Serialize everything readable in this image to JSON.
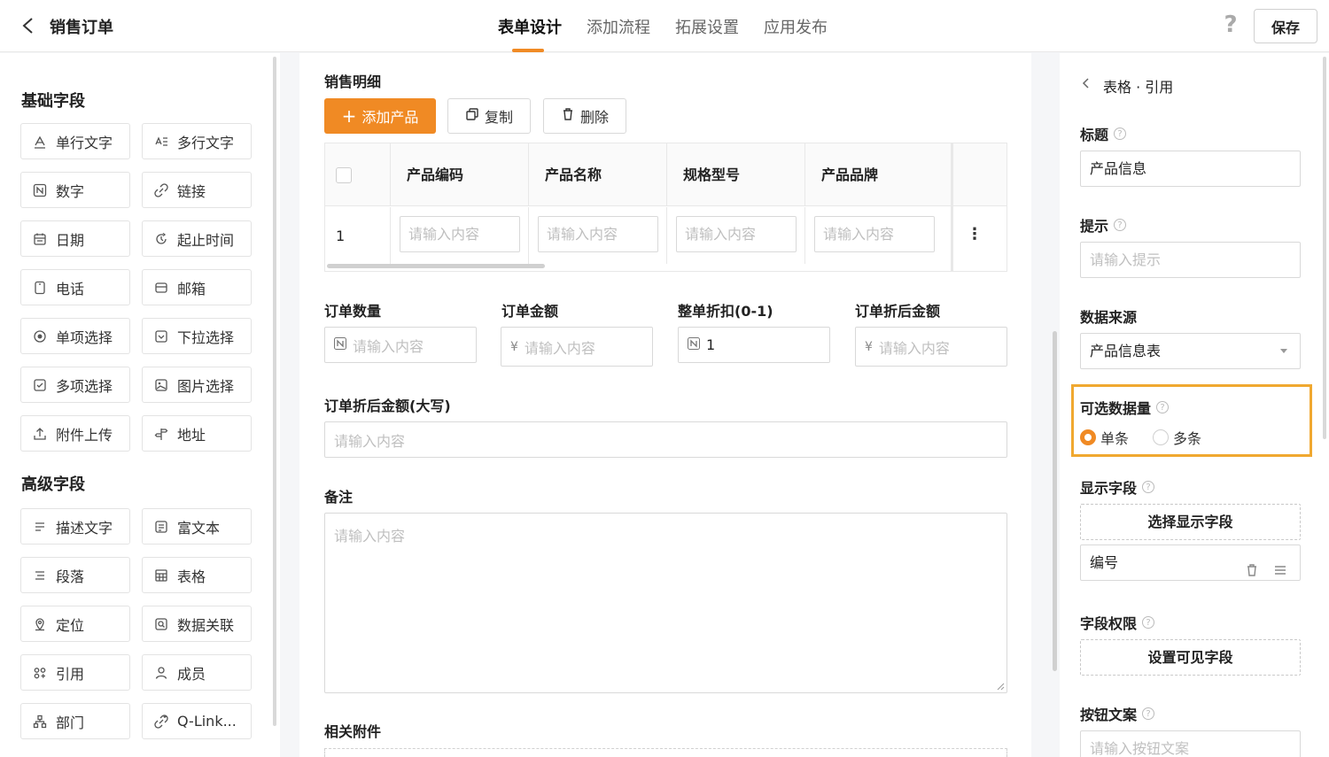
{
  "header": {
    "title": "销售订单",
    "tabs": [
      {
        "label": "表单设计",
        "active": true
      },
      {
        "label": "添加流程",
        "active": false
      },
      {
        "label": "拓展设置",
        "active": false
      },
      {
        "label": "应用发布",
        "active": false
      }
    ],
    "help_label": "?",
    "save_label": "保存",
    "accent_color": "#f08a24"
  },
  "left": {
    "basic_title": "基础字段",
    "basic_fields": [
      {
        "label": "单行文字",
        "icon": "text-line-icon"
      },
      {
        "label": "多行文字",
        "icon": "text-multi-icon"
      },
      {
        "label": "数字",
        "icon": "number-icon"
      },
      {
        "label": "链接",
        "icon": "link-icon"
      },
      {
        "label": "日期",
        "icon": "calendar-icon"
      },
      {
        "label": "起止时间",
        "icon": "time-range-icon"
      },
      {
        "label": "电话",
        "icon": "phone-icon"
      },
      {
        "label": "邮箱",
        "icon": "mail-icon"
      },
      {
        "label": "单项选择",
        "icon": "radio-icon"
      },
      {
        "label": "下拉选择",
        "icon": "dropdown-icon"
      },
      {
        "label": "多项选择",
        "icon": "checkbox-icon"
      },
      {
        "label": "图片选择",
        "icon": "image-icon"
      },
      {
        "label": "附件上传",
        "icon": "upload-icon"
      },
      {
        "label": "地址",
        "icon": "address-icon"
      }
    ],
    "advanced_title": "高级字段",
    "advanced_fields": [
      {
        "label": "描述文字",
        "icon": "description-icon"
      },
      {
        "label": "富文本",
        "icon": "rich-text-icon"
      },
      {
        "label": "段落",
        "icon": "paragraph-icon"
      },
      {
        "label": "表格",
        "icon": "table-icon"
      },
      {
        "label": "定位",
        "icon": "location-icon"
      },
      {
        "label": "数据关联",
        "icon": "data-link-icon"
      },
      {
        "label": "引用",
        "icon": "reference-icon"
      },
      {
        "label": "成员",
        "icon": "member-icon"
      },
      {
        "label": "部门",
        "icon": "department-icon"
      },
      {
        "label": "Q-Link...",
        "icon": "qlink-icon"
      }
    ]
  },
  "center": {
    "detail_title": "销售明细",
    "add_product": "添加产品",
    "copy": "复制",
    "delete": "删除",
    "table": {
      "columns": [
        "产品编码",
        "产品名称",
        "规格型号",
        "产品品牌"
      ],
      "rows": [
        {
          "index": "1",
          "cells": [
            "请输入内容",
            "请输入内容",
            "请输入内容",
            "请输入内容"
          ]
        }
      ]
    },
    "fields": [
      {
        "label": "订单数量",
        "placeholder": "请输入内容",
        "prefix": "N",
        "value": ""
      },
      {
        "label": "订单金额",
        "placeholder": "请输入内容",
        "prefix": "¥",
        "value": ""
      },
      {
        "label": "整单折扣(0-1)",
        "placeholder": "",
        "prefix": "N",
        "value": "1"
      },
      {
        "label": "订单折后金额",
        "placeholder": "请输入内容",
        "prefix": "¥",
        "value": ""
      }
    ],
    "uppercase_label": "订单折后金额(大写)",
    "uppercase_placeholder": "请输入内容",
    "remark_label": "备注",
    "remark_placeholder": "请输入内容",
    "attachment_label": "相关附件"
  },
  "right": {
    "breadcrumb": "表格 · 引用",
    "title_label": "标题",
    "title_value": "产品信息",
    "hint_label": "提示",
    "hint_placeholder": "请输入提示",
    "source_label": "数据来源",
    "source_value": "产品信息表",
    "quantity_label": "可选数据量",
    "quantity_options": [
      {
        "label": "单条",
        "selected": true
      },
      {
        "label": "多条",
        "selected": false
      }
    ],
    "display_label": "显示字段",
    "display_button": "选择显示字段",
    "display_item": "编号",
    "permission_label": "字段权限",
    "permission_button": "设置可见字段",
    "button_text_label": "按钮文案",
    "button_text_placeholder": "请输入按钮文案",
    "highlight_color": "#f0a830"
  }
}
